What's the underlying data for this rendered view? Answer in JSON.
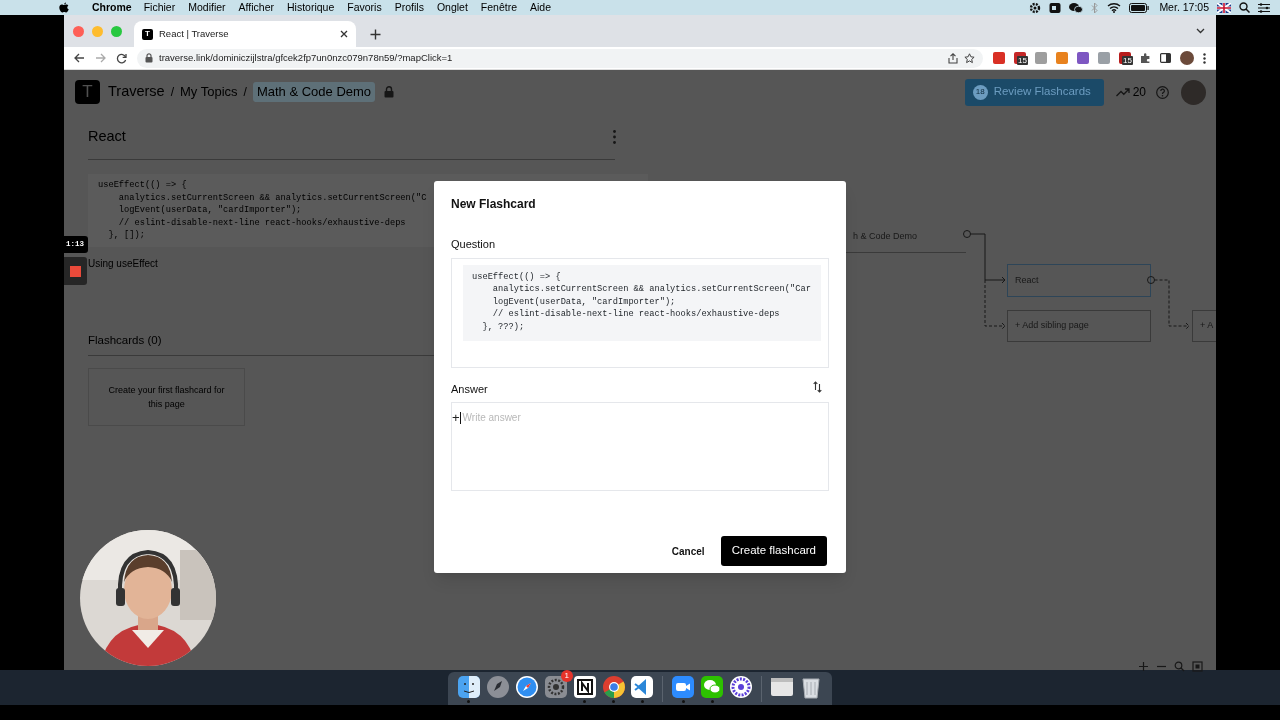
{
  "menu_bar": {
    "app": "Chrome",
    "items": [
      "Fichier",
      "Modifier",
      "Afficher",
      "Historique",
      "Favoris",
      "Profils",
      "Onglet",
      "Fenêtre",
      "Aide"
    ],
    "clock": "Mer. 17:05"
  },
  "browser": {
    "tab": {
      "title": "React | Traverse",
      "favicon": "T"
    },
    "url": "traverse.link/dominiczijlstra/gfcek2fp7un0nzc079n78n59/?mapClick=1",
    "extensions": [
      {
        "color": "#d93025"
      },
      {
        "color": "#c62828",
        "badge": "15"
      },
      {
        "color": "#9e9e9e"
      },
      {
        "color": "#e8821e"
      },
      {
        "color": "#7e57c2"
      },
      {
        "color": "#9aa0a6"
      },
      {
        "color": "#b71c1c",
        "badge": "15"
      }
    ]
  },
  "header": {
    "logo": "T",
    "breadcrumbs": [
      "Traverse",
      "My Topics",
      "Math & Code Demo"
    ],
    "separator": "/",
    "review_button": {
      "count": "18",
      "label": "Review Flashcards"
    },
    "streak": "20"
  },
  "page": {
    "title": "React",
    "code": [
      "useEffect(() => {",
      "    analytics.setCurrentScreen && analytics.setCurrentScreen(\"C",
      "    logEvent(userData, \"cardImporter\");",
      "    // eslint-disable-next-line react-hooks/exhaustive-deps",
      "  }, []);"
    ],
    "caption": "Using useEffect",
    "flashcards_heading": "Flashcards (0)",
    "empty_card": "Create your first flashcard for this page"
  },
  "map": {
    "nodes": [
      {
        "kind": "parent",
        "label": "h & Code Demo"
      },
      {
        "kind": "current",
        "label": "React"
      },
      {
        "kind": "add",
        "label": "+ Add sibling page"
      },
      {
        "kind": "add_child",
        "label": "+ A"
      }
    ]
  },
  "recording": {
    "time": "1:13"
  },
  "modal": {
    "title": "New Flashcard",
    "question_label": "Question",
    "question_code": [
      "useEffect(() => {",
      "    analytics.setCurrentScreen && analytics.setCurrentScreen(\"Car",
      "    logEvent(userData, \"cardImporter\");",
      "    // eslint-disable-next-line react-hooks/exhaustive-deps",
      "  }, ???);"
    ],
    "answer_label": "Answer",
    "add_symbol": "+",
    "answer_placeholder": "Write answer",
    "cancel": "Cancel",
    "create": "Create flashcard"
  },
  "dock": {
    "apps": [
      {
        "kind": "finder",
        "running": true
      },
      {
        "kind": "launchpad",
        "running": false
      },
      {
        "kind": "safari",
        "running": false
      },
      {
        "kind": "settings",
        "running": false,
        "badge": "1"
      },
      {
        "kind": "notion",
        "running": true
      },
      {
        "kind": "chrome",
        "running": true
      },
      {
        "kind": "vscode",
        "running": true
      },
      {
        "kind": "separator"
      },
      {
        "kind": "zoom",
        "running": true
      },
      {
        "kind": "wechat",
        "running": true
      },
      {
        "kind": "flower",
        "running": false
      },
      {
        "kind": "separator"
      },
      {
        "kind": "window",
        "running": false
      },
      {
        "kind": "trash",
        "running": false
      }
    ]
  }
}
